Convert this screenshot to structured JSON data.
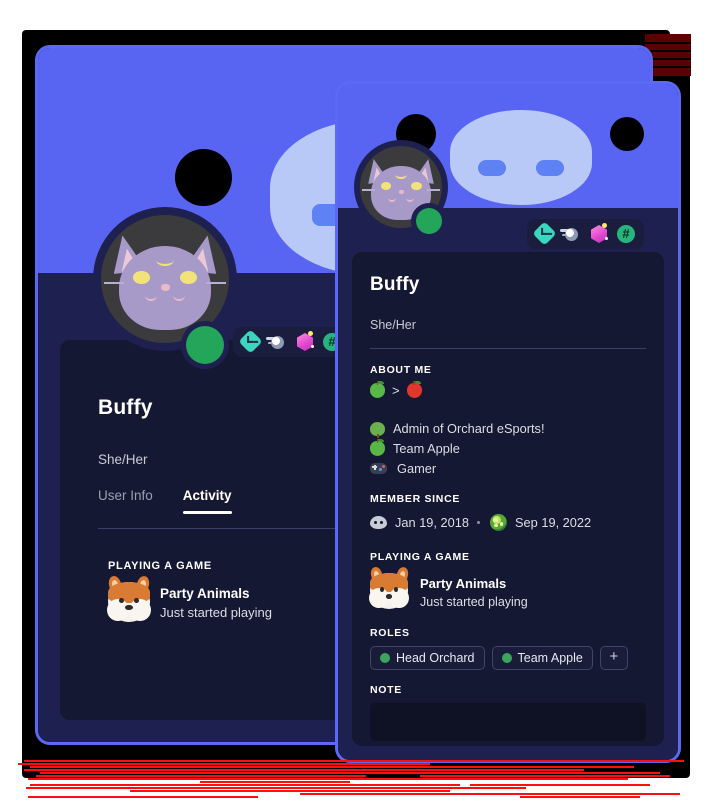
{
  "meta": {
    "app": "Discord",
    "view": "user-profile-card",
    "accent_blurple": "#5865f2",
    "card_body": "#1e2150",
    "card_inner": "#151832",
    "status_color": "#23a55a",
    "note_bg": "#0f1124"
  },
  "back_card": {
    "username": "Buffy",
    "pronouns": "She/Her",
    "tabs": [
      {
        "label": "User Info",
        "active": false
      },
      {
        "label": "Activity",
        "active": true
      }
    ],
    "activity": {
      "heading": "PLAYING A GAME",
      "game_title": "Party Animals",
      "game_state": "Just started playing",
      "game_icon": "corgi-icon"
    },
    "badges": [
      "diamond-badge",
      "comet-badge",
      "gem-badge",
      "hash-badge"
    ],
    "avatar_icon": "cat-avatar",
    "status": "online"
  },
  "front_card": {
    "username": "Buffy",
    "pronouns": "She/Her",
    "badges": [
      "diamond-badge",
      "comet-badge",
      "gem-badge",
      "hash-badge"
    ],
    "avatar_icon": "cat-avatar",
    "status": "online",
    "about": {
      "heading": "ABOUT ME",
      "tagline_left_emoji": "green-apple-emoji",
      "tagline_operator": ">",
      "tagline_right_emoji": "red-apple-emoji",
      "lines": [
        {
          "emoji": "tree-emoji",
          "text": "Admin of Orchard eSports!"
        },
        {
          "emoji": "green-apple-emoji",
          "text": "Team Apple"
        },
        {
          "emoji": "gamepad-emoji",
          "text": "Gamer"
        }
      ]
    },
    "member_since": {
      "heading": "MEMBER SINCE",
      "discord_icon": "discord-logo-icon",
      "discord_date": "Jan 19, 2018",
      "separator": "·",
      "server_icon": "server-icon",
      "server_date": "Sep 19, 2022"
    },
    "activity": {
      "heading": "PLAYING A GAME",
      "game_title": "Party Animals",
      "game_state": "Just started playing",
      "game_icon": "corgi-icon"
    },
    "roles": {
      "heading": "ROLES",
      "items": [
        {
          "label": "Head Orchard",
          "color": "#3ba55d"
        },
        {
          "label": "Team Apple",
          "color": "#3ba55d"
        }
      ],
      "add_label": "+"
    },
    "note": {
      "heading": "NOTE",
      "value": "",
      "placeholder": ""
    }
  }
}
